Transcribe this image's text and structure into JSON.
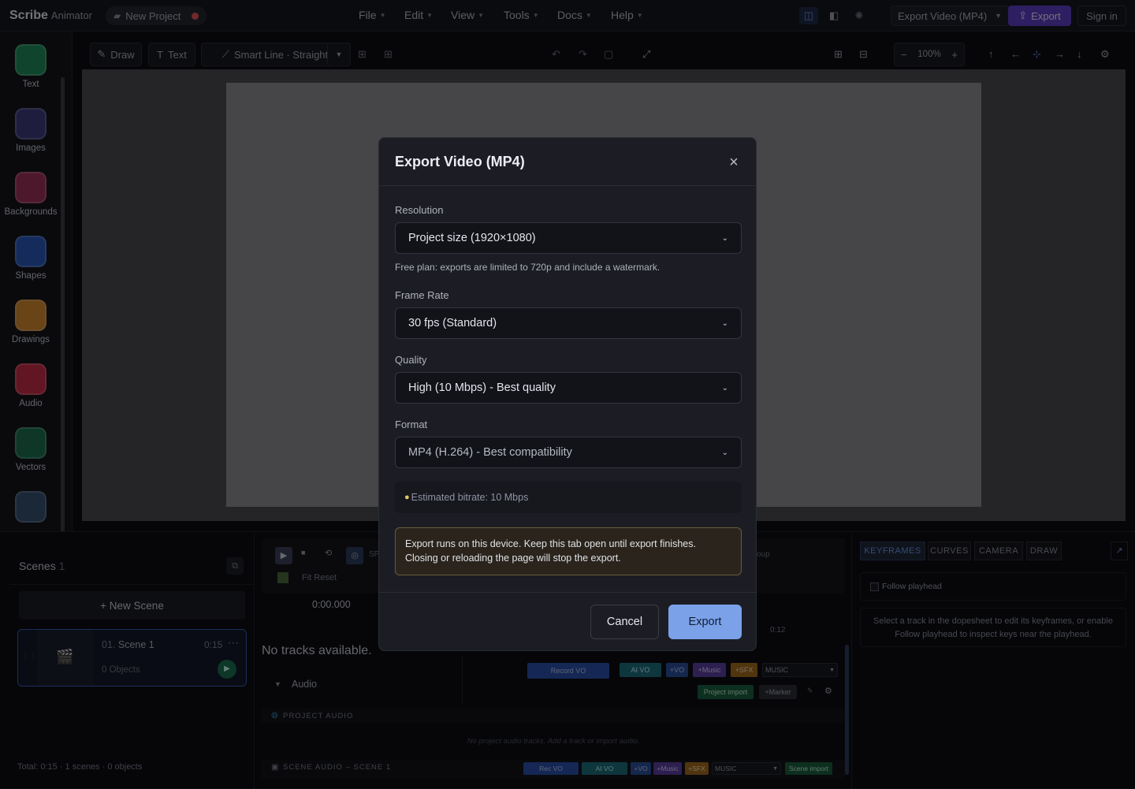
{
  "app": {
    "brand": "Scribe",
    "brand_sub": "Animator",
    "project_name": "New Project"
  },
  "menus": [
    {
      "label": "File"
    },
    {
      "label": "Edit"
    },
    {
      "label": "View"
    },
    {
      "label": "Tools"
    },
    {
      "label": "Docs"
    },
    {
      "label": "Help"
    }
  ],
  "topright": {
    "export_select": "Export Video (MP4)",
    "export_button": "Export",
    "sign_in": "Sign in"
  },
  "rail": [
    {
      "label": "Text"
    },
    {
      "label": "Images"
    },
    {
      "label": "Backgrounds"
    },
    {
      "label": "Shapes"
    },
    {
      "label": "Drawings"
    },
    {
      "label": "Audio"
    },
    {
      "label": "Vectors"
    }
  ],
  "toolbar": {
    "draw": "Draw",
    "text": "Text",
    "smart_line": "Smart Line · Straight",
    "zoom": "100%"
  },
  "scenes": {
    "title": "Scenes",
    "count": "1",
    "new_scene": "+ New Scene",
    "card": {
      "number": "01.",
      "name": "Scene 1",
      "duration": "0:15",
      "objects": "0 Objects"
    },
    "total": "Total: 0:15 · 1 scenes · 0 objects"
  },
  "timeline": {
    "fit_reset": "Fit Reset",
    "time": "0:00.000",
    "no_tracks": "No tracks available.",
    "audio_label": "Audio",
    "project_audio": "PROJECT AUDIO",
    "empty_audio": "No project audio tracks. Add a track or import audio.",
    "scene_audio": "SCENE AUDIO – SCENE 1",
    "ruler_tick": "0:12",
    "chips_top": {
      "record": "Record VO",
      "ai_vo": "AI VO",
      "vo": "+VO",
      "music": "+Music",
      "sfx": "+SFX",
      "music_sel": "MUSIC",
      "import": "Project import",
      "marker": "+Marker"
    },
    "chips_bottom": {
      "record": "Rec VO",
      "ai_vo": "AI VO",
      "vo": "+VO",
      "music": "+Music",
      "sfx": "+SFX",
      "music_sel": "MUSIC",
      "import": "Scene import"
    },
    "behind_modal_1": "SP",
    "behind_modal_2": "oup"
  },
  "keyframes": {
    "tabs": [
      "KEYFRAMES",
      "CURVES",
      "CAMERA",
      "DRAW"
    ],
    "follow": "Follow playhead",
    "hint": "Select a track in the dopesheet to edit its keyframes, or enable Follow playhead to inspect keys near the playhead."
  },
  "modal": {
    "title": "Export Video (MP4)",
    "resolution_label": "Resolution",
    "resolution_value": "Project size (1920×1080)",
    "resolution_hint": "Free plan: exports are limited to 720p and include a watermark.",
    "framerate_label": "Frame Rate",
    "framerate_value": "30 fps (Standard)",
    "quality_label": "Quality",
    "quality_value": "High (10 Mbps) - Best quality",
    "format_label": "Format",
    "format_value": "MP4 (H.264) - Best compatibility",
    "bitrate": "Estimated bitrate: 10 Mbps",
    "warning_line1": "Export runs on this device. Keep this tab open until export finishes.",
    "warning_line2": "Closing or reloading the page will stop the export.",
    "cancel": "Cancel",
    "export": "Export"
  },
  "colors": {
    "accent": "#5b3ec4",
    "primary_button": "#7ba2e8",
    "warning_border": "#6a5a3a"
  }
}
